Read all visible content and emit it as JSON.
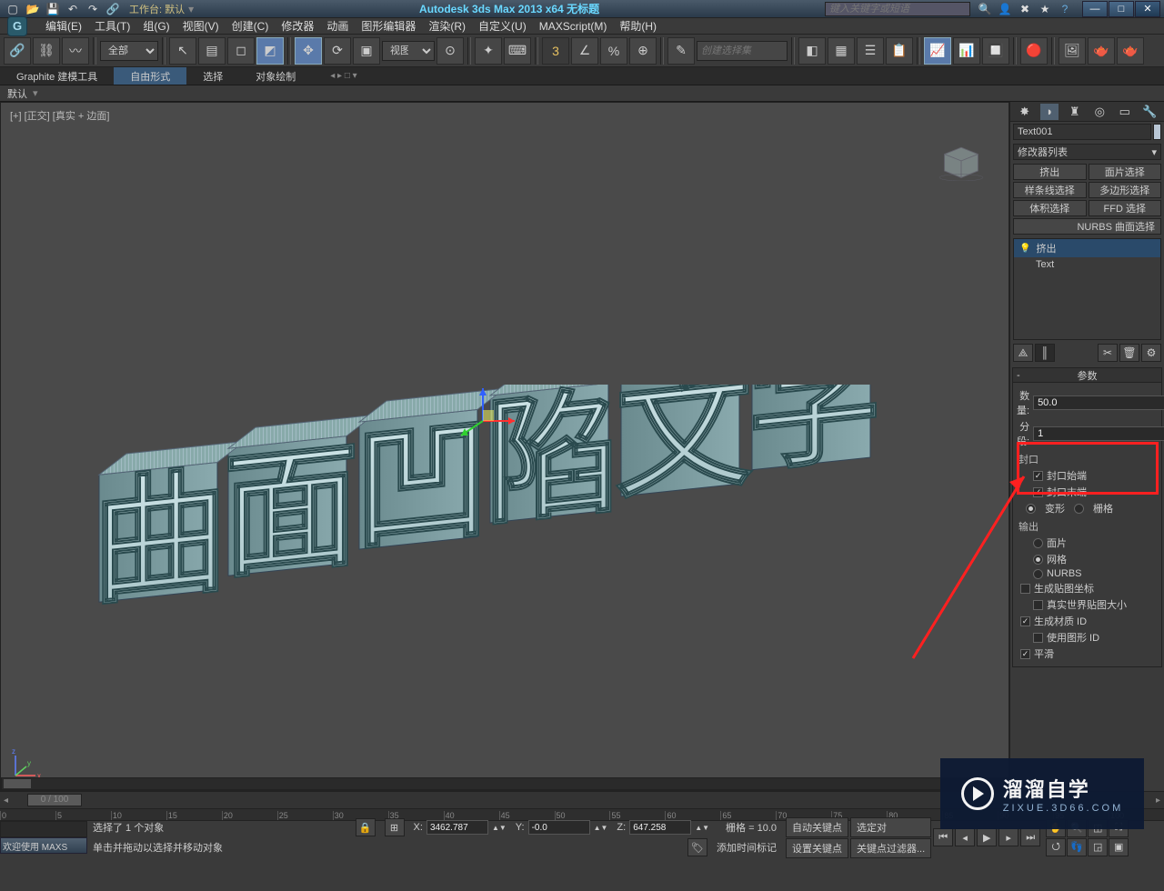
{
  "title_bar": {
    "workspace": "工作台: 默认",
    "app_title": "Autodesk 3ds Max  2013 x64    无标题",
    "search_placeholder": "键入关键字或短语"
  },
  "menu": [
    "编辑(E)",
    "工具(T)",
    "组(G)",
    "视图(V)",
    "创建(C)",
    "修改器",
    "动画",
    "图形编辑器",
    "渲染(R)",
    "自定义(U)",
    "MAXScript(M)",
    "帮助(H)"
  ],
  "toolbar": {
    "filter_label": "全部",
    "view_label": "视图",
    "selset_placeholder": "创建选择集"
  },
  "ribbon": {
    "tabs": [
      "Graphite 建模工具",
      "自由形式",
      "选择",
      "对象绘制"
    ],
    "sub": "默认"
  },
  "viewport": {
    "label": "[+] [正交] [真实 + 边面]"
  },
  "panel": {
    "object_name": "Text001",
    "modifier_dd": "修改器列表",
    "sub_buttons": [
      "挤出",
      "面片选择",
      "样条线选择",
      "多边形选择",
      "体积选择",
      "FFD 选择"
    ],
    "nurbs_btn": "NURBS 曲面选择",
    "stack": [
      {
        "icon": "💡",
        "label": "挤出",
        "sel": true
      },
      {
        "icon": "",
        "label": "Text",
        "sel": false
      }
    ],
    "rollout_title": "参数",
    "params": {
      "amount_label": "数量:",
      "amount_value": "50.0",
      "segments_label": "分段:",
      "segments_value": "1"
    },
    "cap_group": "封口",
    "cap_start": "封口始端",
    "cap_end": "封口末端",
    "morph": "变形",
    "grid": "栅格",
    "output_group": "输出",
    "out_patch": "面片",
    "out_mesh": "网格",
    "out_nurbs": "NURBS",
    "gen_map": "生成贴图坐标",
    "real_world": "真实世界贴图大小",
    "gen_matid": "生成材质 ID",
    "use_shapeid": "使用图形 ID",
    "smooth": "平滑"
  },
  "timeline": {
    "slider": "0 / 100"
  },
  "status": {
    "welcome": "欢迎使用  MAXS",
    "selected": "选择了 1 个对象",
    "hint": "单击并拖动以选择并移动对象",
    "x": "3462.787",
    "y": "-0.0",
    "z": "647.258",
    "grid": "栅格 = 10.0",
    "auto_key": "自动关键点",
    "set_key": "设置关键点",
    "sel_obj": "选定对",
    "key_filter": "关键点过滤器...",
    "add_time": "添加时间标记"
  },
  "watermark": {
    "main": "溜溜自学",
    "sub": "ZIXUE.3D66.COM"
  }
}
